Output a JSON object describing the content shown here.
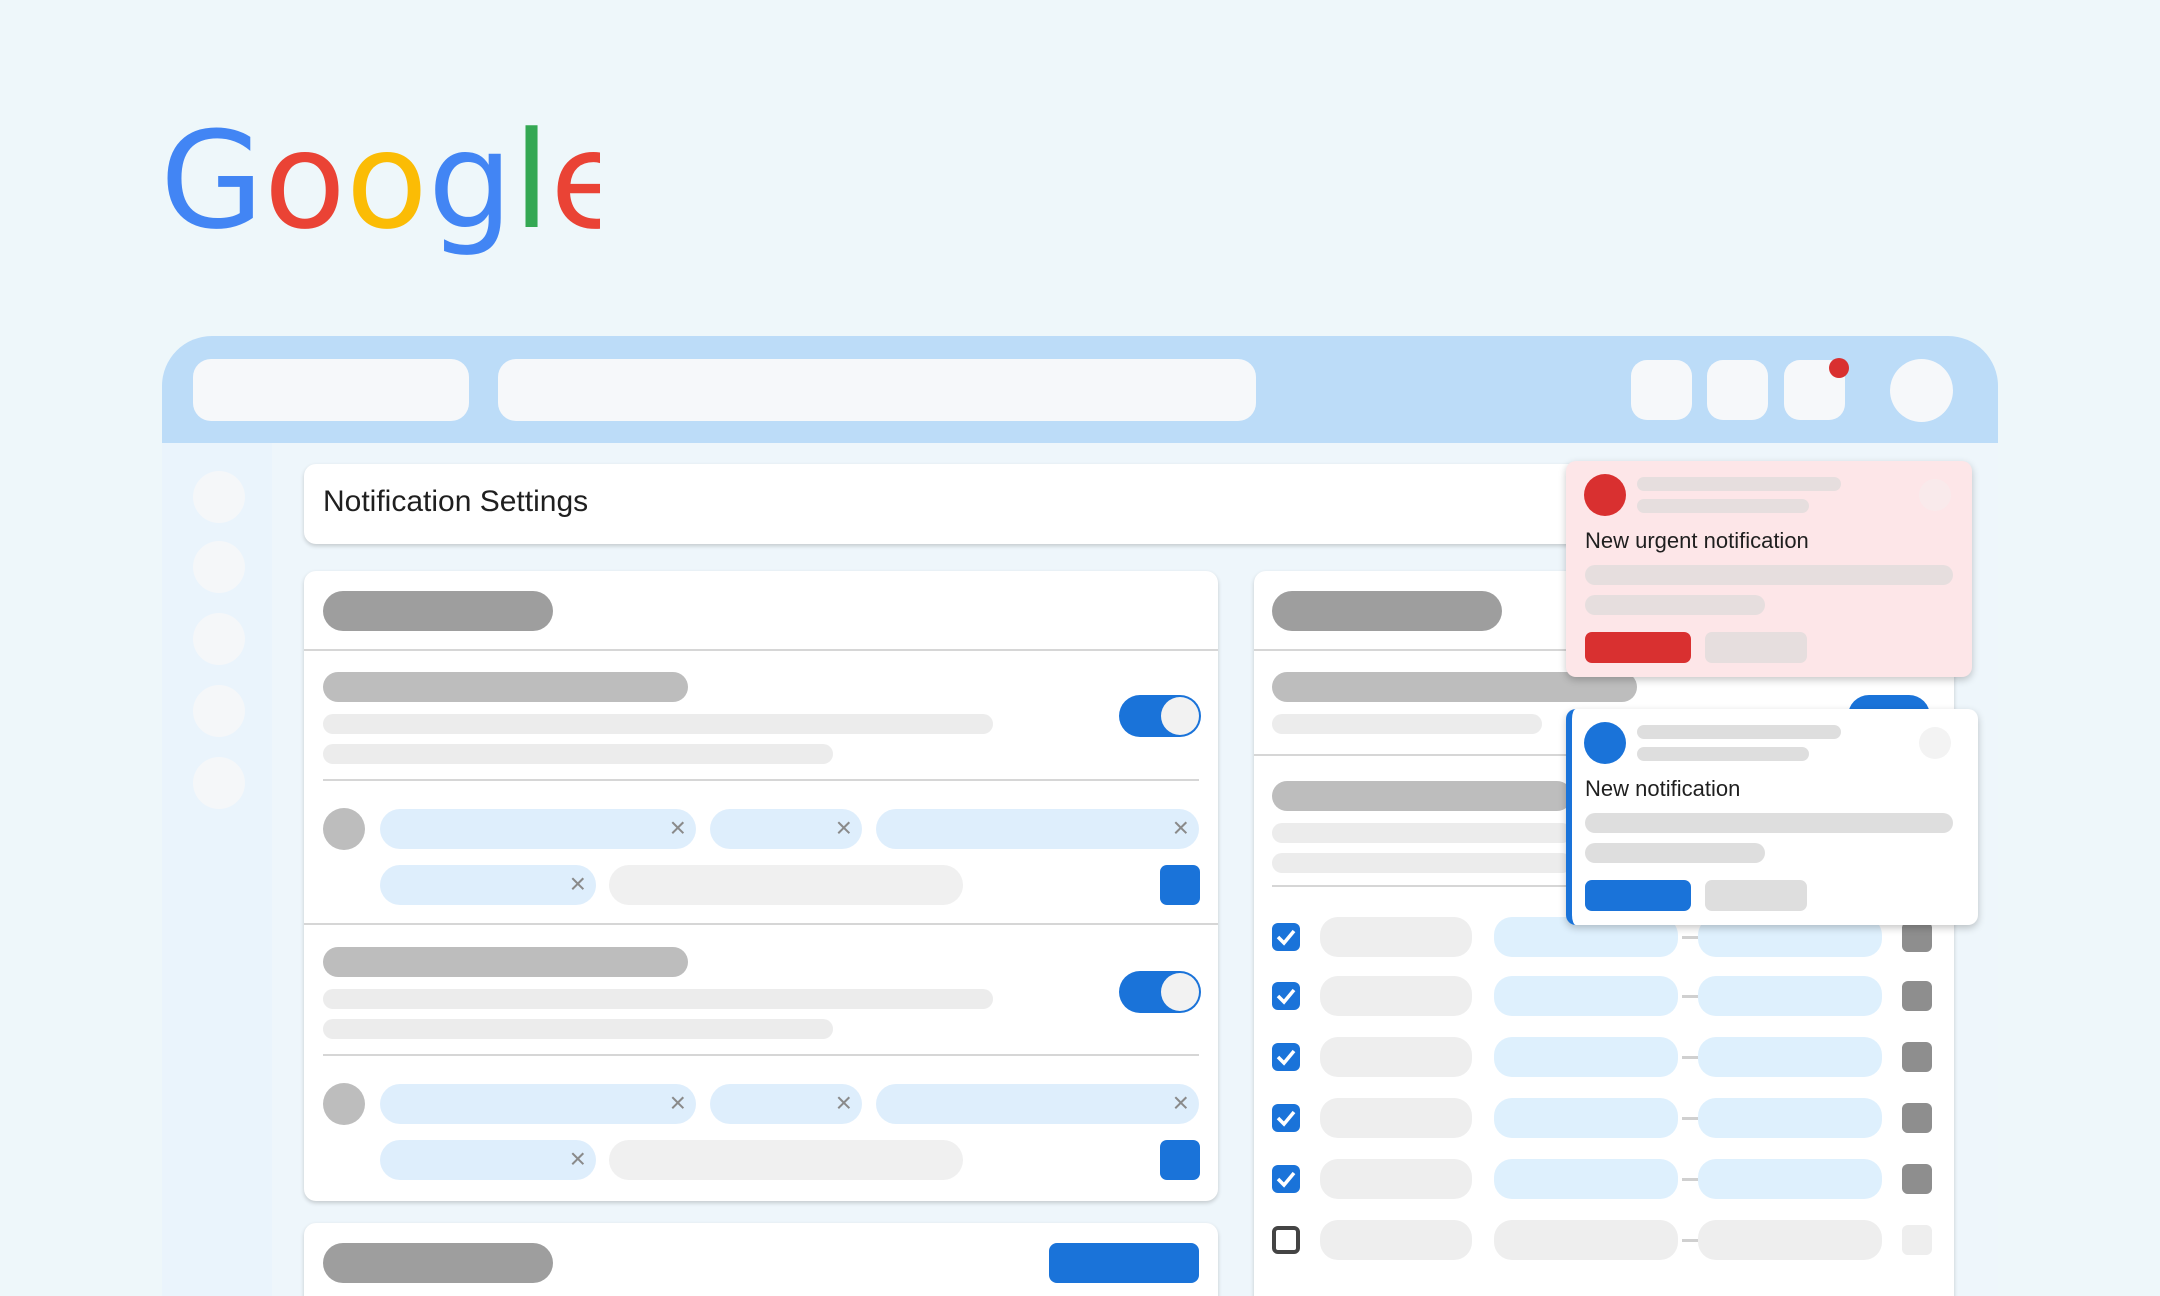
{
  "brand": {
    "logo_letters": [
      "G",
      "o",
      "o",
      "g",
      "l",
      "e"
    ],
    "colors": [
      "#4285F4",
      "#EA4335",
      "#FBBC05",
      "#4285F4",
      "#34A853",
      "#EA4335"
    ]
  },
  "page": {
    "title": "Notification Settings"
  },
  "notifications": {
    "urgent": {
      "title": "New urgent notification",
      "accent": "#d93030"
    },
    "normal": {
      "title": "New notification",
      "accent": "#1a73d9"
    }
  },
  "settings": {
    "left_sections": [
      {
        "toggle_on": true,
        "tags": 4
      },
      {
        "toggle_on": true,
        "tags": 4
      }
    ],
    "right_rows": [
      {
        "checked": true
      },
      {
        "checked": true
      },
      {
        "checked": true
      },
      {
        "checked": true
      },
      {
        "checked": true
      },
      {
        "checked": false
      }
    ]
  },
  "icons": {
    "chip_remove": "×",
    "close": "close-icon",
    "check": "check-icon"
  }
}
